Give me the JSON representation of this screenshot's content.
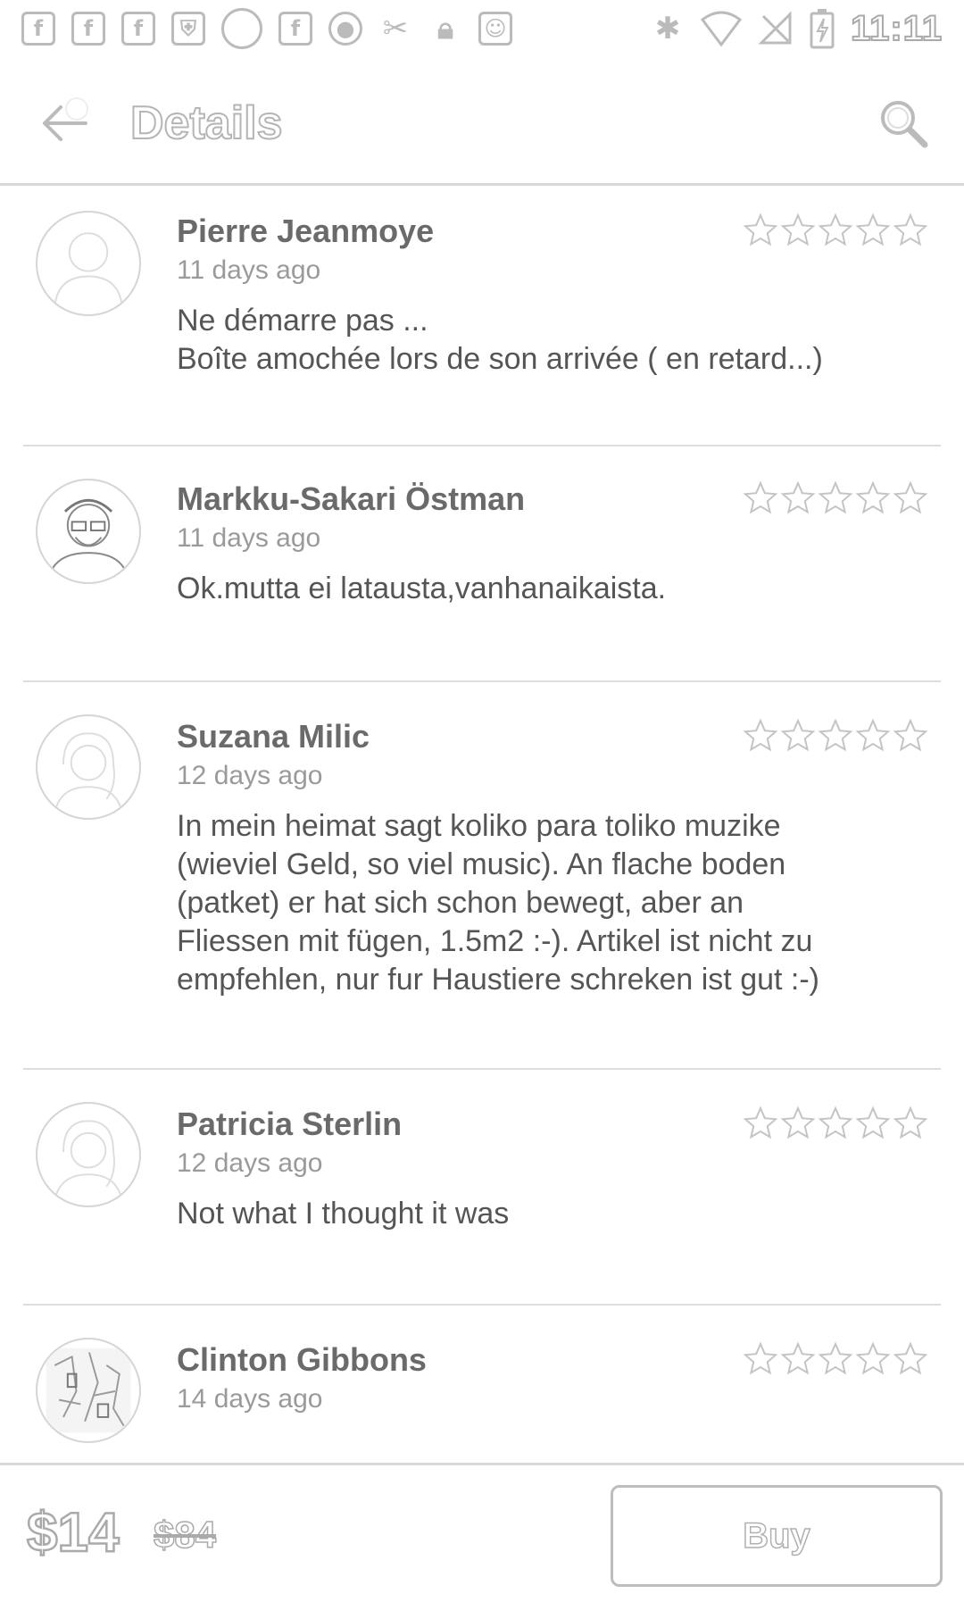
{
  "status_bar": {
    "time": "11:11",
    "left_icons": [
      "facebook-icon",
      "facebook-icon",
      "facebook-icon",
      "shield-icon",
      "circle-icon",
      "facebook-icon",
      "record-icon",
      "tool-icon",
      "lock-icon",
      "android-icon"
    ],
    "right_icons": [
      "bluetooth-icon",
      "wifi-icon",
      "no-signal-icon",
      "battery-charging-icon"
    ]
  },
  "app_bar": {
    "title": "Details"
  },
  "reviews": [
    {
      "name": "Pierre Jeanmoye",
      "time": "11 days ago",
      "text": "Ne démarre pas ...\nBoîte amochée lors de son arrivée ( en retard...)",
      "rating": 0,
      "avatar": "default"
    },
    {
      "name": "Markku-Sakari Östman",
      "time": "11 days ago",
      "text": "Ok.mutta ei latausta,vanhanaikaista.",
      "rating": 0,
      "avatar": "photo"
    },
    {
      "name": "Suzana Milic",
      "time": "12 days ago",
      "text": "In mein heimat sagt  koliko para toliko muzike\n(wieviel Geld, so viel music). An flache boden\n(patket) er hat sich schon bewegt, aber an\nFliessen mit fügen, 1.5m2 :-). Artikel ist nicht zu\nempfehlen, nur fur Haustiere schreken ist gut :-)",
      "rating": 0,
      "avatar": "default"
    },
    {
      "name": "Patricia Sterlin",
      "time": "12 days ago",
      "text": "Not what I thought it was",
      "rating": 0,
      "avatar": "default"
    },
    {
      "name": "Clinton Gibbons",
      "time": "14 days ago",
      "text": "",
      "rating": 0,
      "avatar": "photo"
    }
  ],
  "bottom_bar": {
    "price": "$14",
    "old_price": "$84",
    "buy_label": "Buy"
  }
}
